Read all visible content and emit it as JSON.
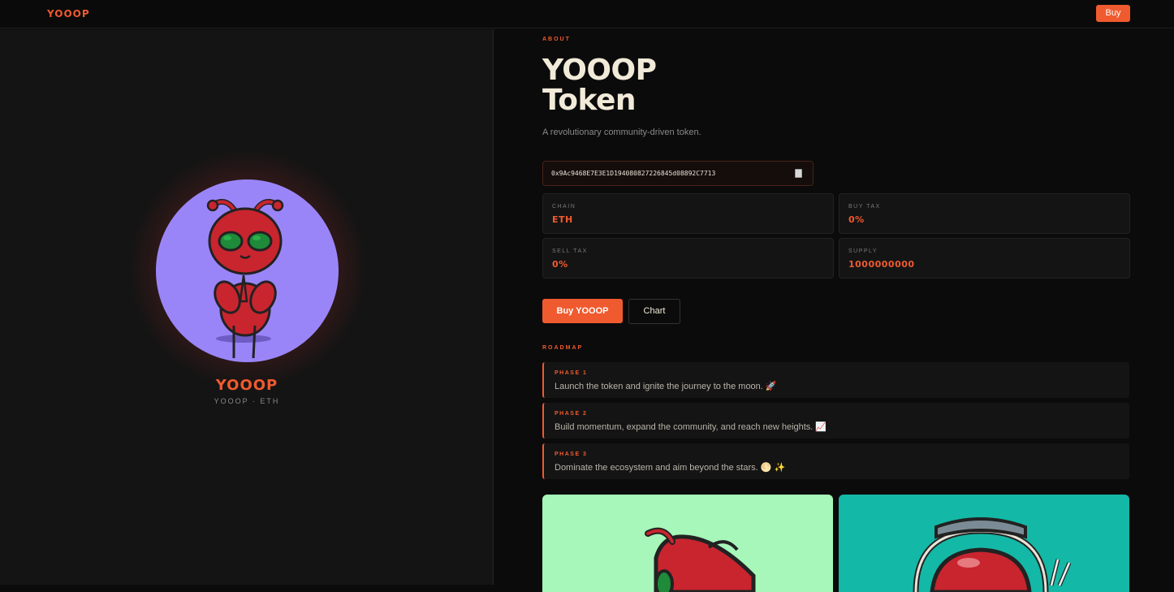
{
  "header": {
    "logo": "YOOOP",
    "buy_label": "Buy"
  },
  "hero": {
    "brand": "YOOOP",
    "tagline": "YOOOP · ETH",
    "avatar_bg": "#9a85f8"
  },
  "about": {
    "label": "ABOUT",
    "title_line1": "YOOOP",
    "title_line2": "Token",
    "description": "A revolutionary community-driven token.",
    "contract": "0x9Ac9468E7E3E1D19408082722684 5d08892C7713",
    "copy_icon": "clipboard-icon"
  },
  "stats": [
    {
      "label": "CHAIN",
      "value": "ETH"
    },
    {
      "label": "BUY TAX",
      "value": "0%"
    },
    {
      "label": "SELL TAX",
      "value": "0%"
    },
    {
      "label": "SUPPLY",
      "value": "1000000000"
    }
  ],
  "actions": {
    "buy_label": "Buy YOOOP",
    "chart_label": "Chart"
  },
  "roadmap": {
    "label": "ROADMAP",
    "phases": [
      {
        "label": "PHASE 1",
        "text": "Launch the token and ignite the journey to the moon. 🚀"
      },
      {
        "label": "PHASE 2",
        "text": "Build momentum, expand the community, and reach new heights. 📈"
      },
      {
        "label": "PHASE 3",
        "text": "Dominate the ecosystem and aim beyond the stars. 🌕 ✨"
      }
    ]
  },
  "gallery": [
    {
      "bg": "#a6f7b9"
    },
    {
      "bg": "#14b8a6"
    }
  ],
  "colors": {
    "accent": "#f05a2f",
    "background": "#0b0b0b",
    "panel": "#141414"
  }
}
